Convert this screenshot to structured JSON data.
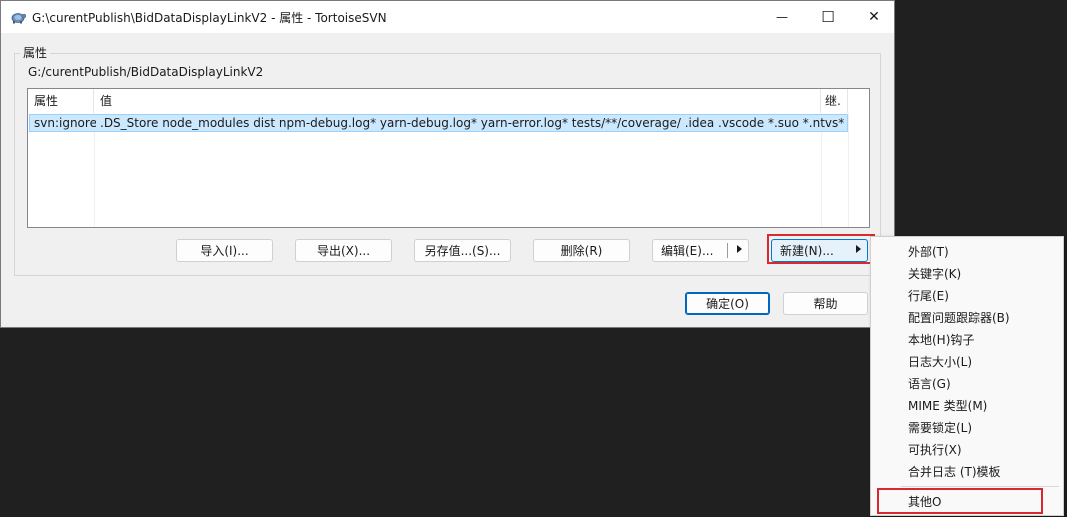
{
  "window": {
    "title": "G:\\curentPublish\\BidDataDisplayLinkV2 - 属性 - TortoiseSVN",
    "minimize_glyph": "—",
    "maximize_glyph": "☐",
    "close_glyph": "✕"
  },
  "group": {
    "legend": "属性",
    "path": "G:/curentPublish/BidDataDisplayLinkV2"
  },
  "table": {
    "columns": [
      "属性",
      "值",
      "继."
    ],
    "rows": [
      {
        "property": "svn:ignore",
        "value": ".DS_Store node_modules dist npm-debug.log* yarn-debug.log* yarn-error.log* tests/**/coverage/ .idea .vscode *.suo *.ntvs* *.njsproj ..."
      }
    ]
  },
  "buttons": {
    "import": "导入(I)...",
    "export": "导出(X)...",
    "save_value": "另存值...(S)...",
    "delete": "删除(R)",
    "edit": "编辑(E)...",
    "new": "新建(N)...",
    "ok": "确定(O)",
    "help": "帮助"
  },
  "menu": {
    "items": [
      "外部(T)",
      "关键字(K)",
      "行尾(E)",
      "配置问题跟踪器(B)",
      "本地(H)钩子",
      "日志大小(L)",
      "语言(G)",
      "MIME 类型(M)",
      "需要锁定(L)",
      "可执行(X)",
      "合并日志 (T)模板"
    ],
    "other": "其他O"
  },
  "colors": {
    "accent": "#0067c0",
    "selection": "#cce8ff",
    "highlight_annotation": "#d9282f"
  },
  "icons": {
    "app": "tortoisesvn-turtle-icon",
    "submenu": "chevron-right-icon"
  }
}
